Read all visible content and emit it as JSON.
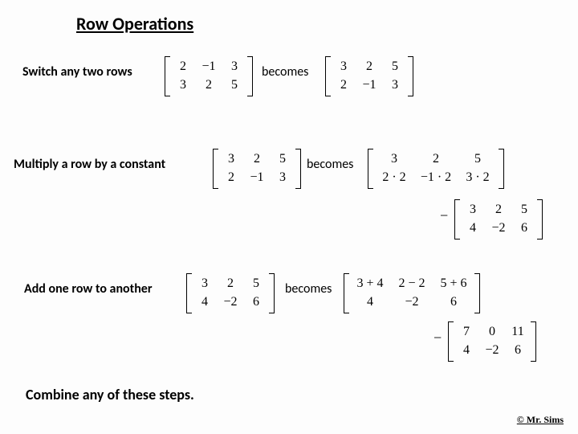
{
  "title": "Row Operations",
  "ops": {
    "switch_label": "Switch any two rows",
    "multiply_label": "Multiply a row by a constant",
    "add_label": "Add one row to another",
    "combine_label": "Combine any of these steps."
  },
  "becomes": "becomes",
  "neg": "−",
  "matrices": {
    "switch_before": {
      "r1": [
        "2",
        "−1",
        "3"
      ],
      "r2": [
        "3",
        "2",
        "5"
      ]
    },
    "switch_after": {
      "r1": [
        "3",
        "2",
        "5"
      ],
      "r2": [
        "2",
        "−1",
        "3"
      ]
    },
    "mult_before": {
      "r1": [
        "3",
        "2",
        "5"
      ],
      "r2": [
        "2",
        "−1",
        "3"
      ]
    },
    "mult_after": {
      "r1": [
        "3",
        "2",
        "5"
      ],
      "r2": [
        "2 · 2",
        "−1 · 2",
        "3 · 2"
      ]
    },
    "mult_result": {
      "r1": [
        "3",
        "2",
        "5"
      ],
      "r2": [
        "4",
        "−2",
        "6"
      ]
    },
    "add_before": {
      "r1": [
        "3",
        "2",
        "5"
      ],
      "r2": [
        "4",
        "−2",
        "6"
      ]
    },
    "add_after": {
      "r1": [
        "3 + 4",
        "2 − 2",
        "5 + 6"
      ],
      "r2": [
        "4",
        "−2",
        "6"
      ]
    },
    "add_result": {
      "r1": [
        "7",
        "0",
        "11"
      ],
      "r2": [
        "4",
        "−2",
        "6"
      ]
    }
  },
  "footnote": "© Mr. Sims"
}
